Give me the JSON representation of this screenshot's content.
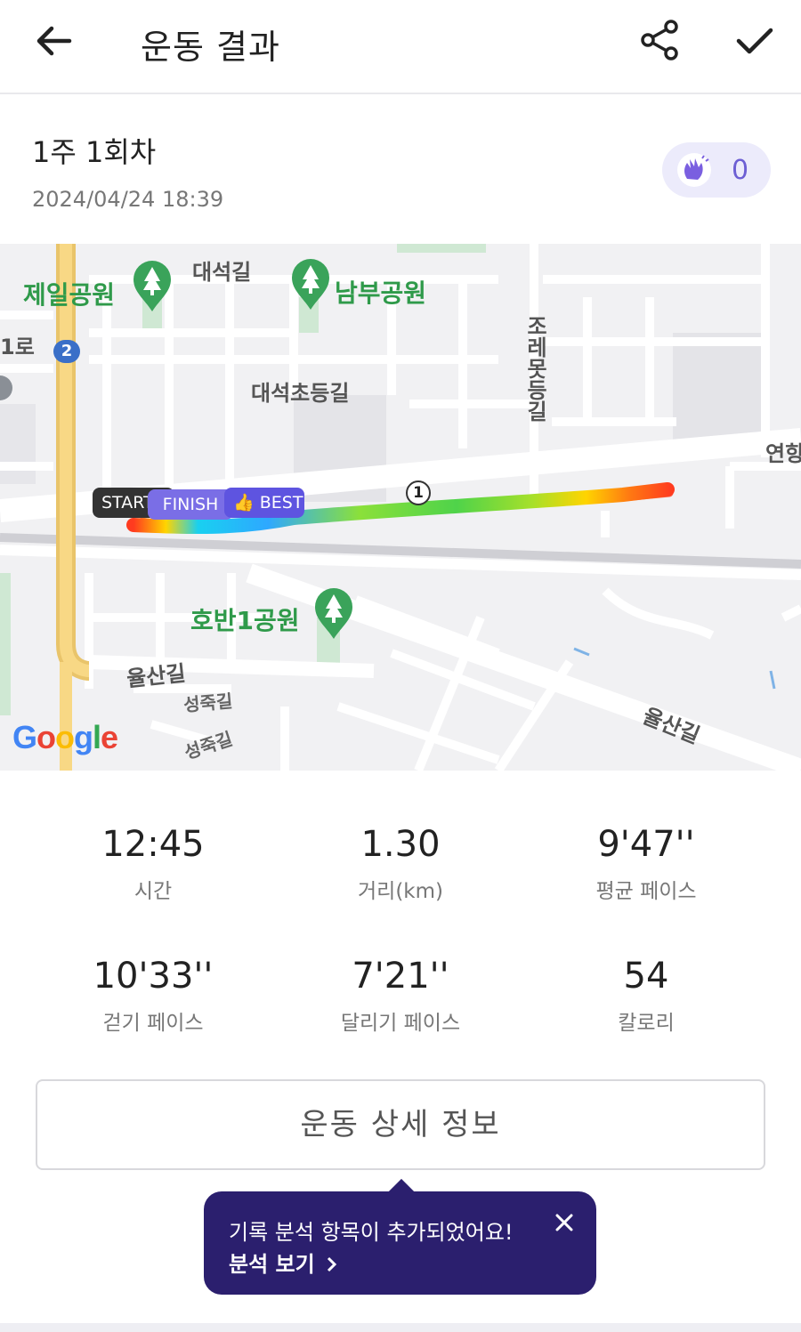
{
  "header": {
    "title": "운동 결과",
    "back_icon": "arrow-left-icon",
    "share_icon": "share-icon",
    "confirm_icon": "check-icon"
  },
  "session": {
    "name": "1주 1회차",
    "datetime": "2024/04/24 18:39",
    "clap_icon": "clap-hands-icon",
    "clap_count": "0"
  },
  "map": {
    "labels": {
      "park1": "제일공원",
      "park2": "남부공원",
      "park3": "호반1공원",
      "road_daeseok": "대석길",
      "road_daeseok_elem": "대석초등길",
      "road_jorebot": "조레못등길",
      "road_yulsan1": "율산길",
      "road_yulsan2": "율산길",
      "road_seongjuk1": "성죽길",
      "road_seongjuk2": "성죽길",
      "road_ro": "1로",
      "road_yeon": "연향",
      "route_shield": "2"
    },
    "tags": {
      "start": "START",
      "finish": "FINISH",
      "best": "BEST"
    },
    "km_marker": "1",
    "attribution": "Google",
    "colors": {
      "park": "#2f9a4a",
      "route_start": "#ff3b1f",
      "route_end": "#2ea8ff",
      "major_road": "#f6c760"
    }
  },
  "stats": [
    {
      "value": "12:45",
      "label": "시간"
    },
    {
      "value": "1.30",
      "label": "거리(km)"
    },
    {
      "value": "9'47''",
      "label": "평균 페이스"
    },
    {
      "value": "10'33''",
      "label": "걷기 페이스"
    },
    {
      "value": "7'21''",
      "label": "달리기 페이스"
    },
    {
      "value": "54",
      "label": "칼로리"
    }
  ],
  "detail_button": "운동 상세 정보",
  "tooltip": {
    "message": "기록 분석 항목이 추가되었어요!",
    "link": "분석 보기",
    "link_icon": "chevron-right-icon",
    "close_icon": "close-icon"
  },
  "theme": {
    "accent": "#5e54e0",
    "tooltip_bg": "#2b1f6e"
  }
}
